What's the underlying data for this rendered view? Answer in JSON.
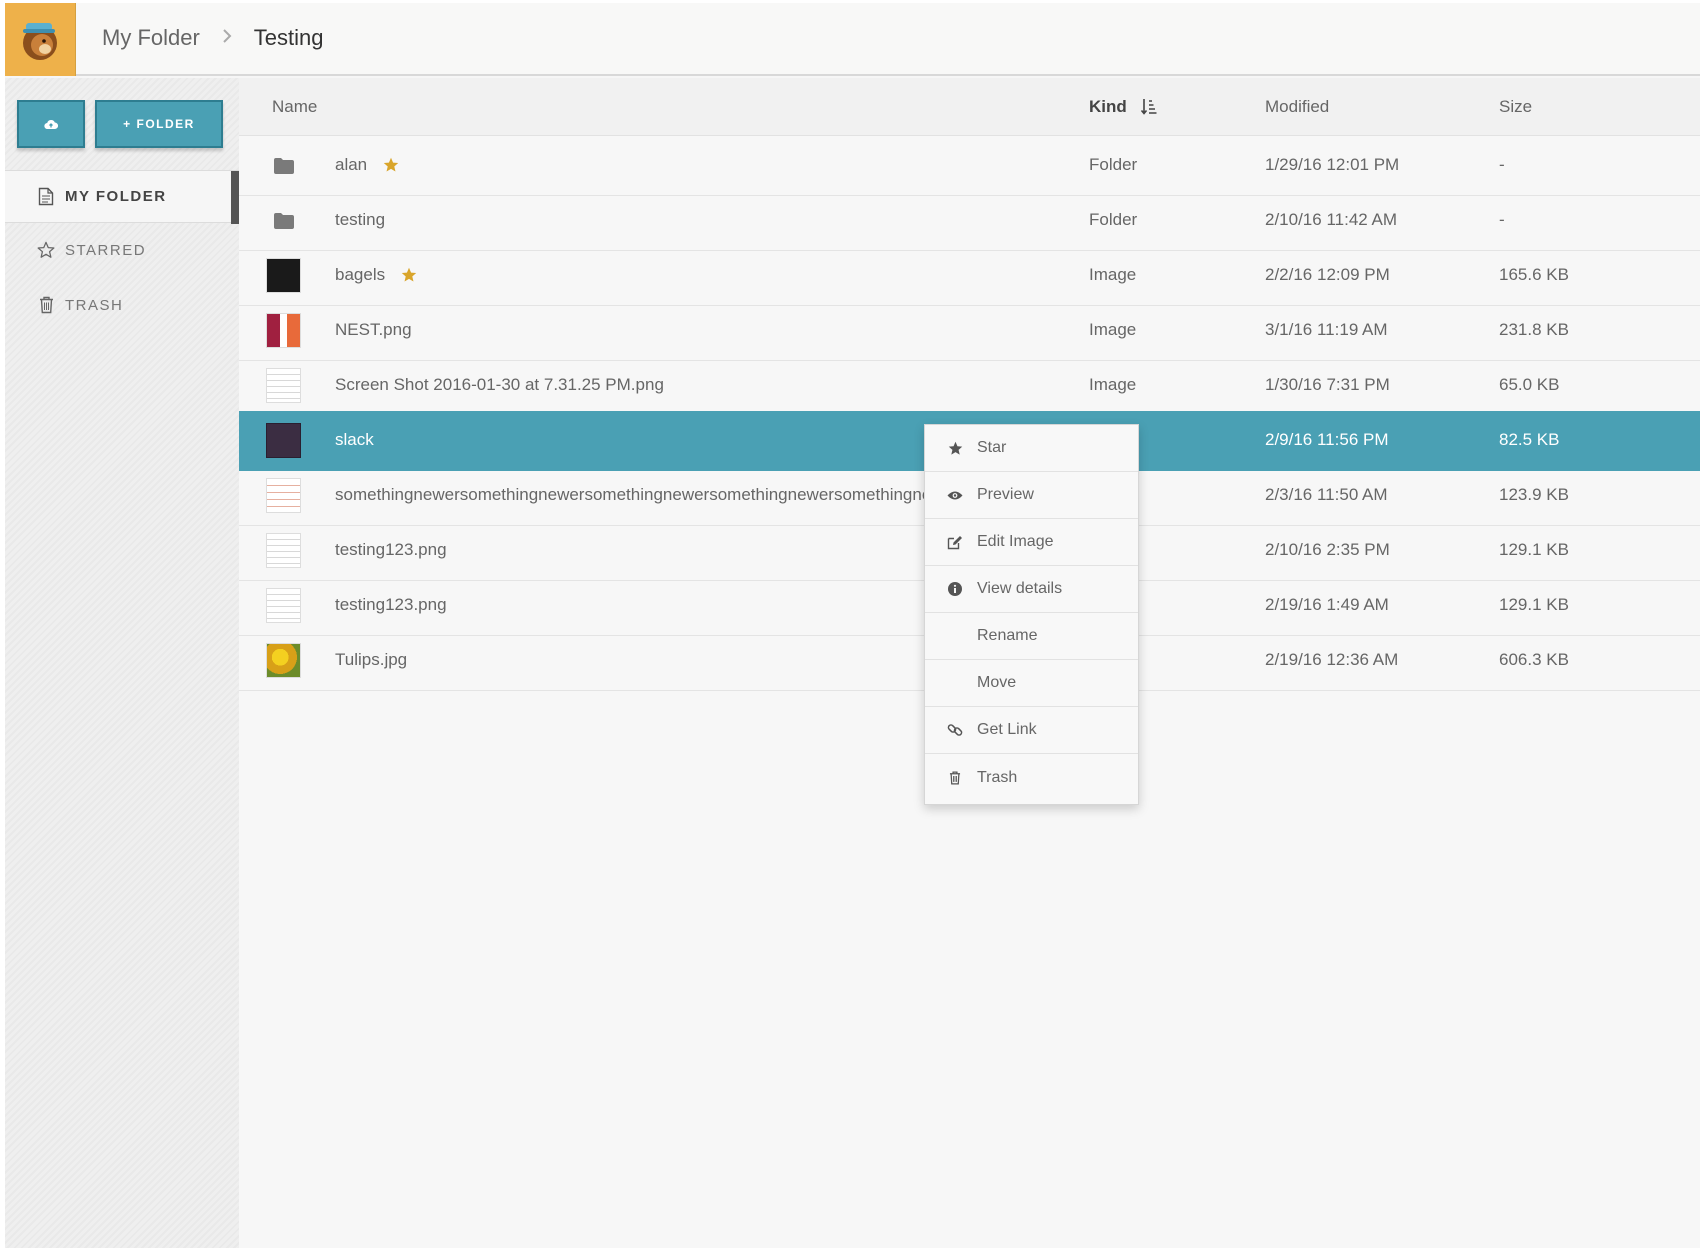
{
  "header": {
    "breadcrumb_parent": "My Folder",
    "breadcrumb_current": "Testing"
  },
  "sidebar": {
    "upload_icon": "cloud-upload-icon",
    "new_folder_label": "+ FOLDER",
    "items": [
      {
        "label": "MY FOLDER",
        "icon": "document-icon",
        "active": true
      },
      {
        "label": "STARRED",
        "icon": "star-outline-icon",
        "active": false
      },
      {
        "label": "TRASH",
        "icon": "trash-icon",
        "active": false
      }
    ]
  },
  "table": {
    "columns": {
      "name": "Name",
      "kind": "Kind",
      "modified": "Modified",
      "size": "Size"
    },
    "sorted_by": "Kind",
    "rows": [
      {
        "name": "alan",
        "starred": true,
        "kind": "Folder",
        "modified": "1/29/16 12:01 PM",
        "size": "-"
      },
      {
        "name": "testing",
        "starred": false,
        "kind": "Folder",
        "modified": "2/10/16 11:42 AM",
        "size": "-"
      },
      {
        "name": "bagels",
        "starred": true,
        "kind": "Image",
        "modified": "2/2/16 12:09 PM",
        "size": "165.6 KB"
      },
      {
        "name": "NEST.png",
        "starred": false,
        "kind": "Image",
        "modified": "3/1/16 11:19 AM",
        "size": "231.8 KB"
      },
      {
        "name": "Screen Shot 2016-01-30 at 7.31.25 PM.png",
        "starred": false,
        "kind": "Image",
        "modified": "1/30/16 7:31 PM",
        "size": "65.0 KB"
      },
      {
        "name": "slack",
        "starred": false,
        "kind": "",
        "modified": "2/9/16 11:56 PM",
        "size": "82.5 KB",
        "selected": true
      },
      {
        "name": "somethingnewersomethingnewersomethingnewersomethingnewersomethingnewerso",
        "starred": false,
        "kind": "",
        "modified": "2/3/16 11:50 AM",
        "size": "123.9 KB"
      },
      {
        "name": "testing123.png",
        "starred": false,
        "kind": "",
        "modified": "2/10/16 2:35 PM",
        "size": "129.1 KB"
      },
      {
        "name": "testing123.png",
        "starred": false,
        "kind": "",
        "modified": "2/19/16 1:49 AM",
        "size": "129.1 KB"
      },
      {
        "name": "Tulips.jpg",
        "starred": false,
        "kind": "",
        "modified": "2/19/16 12:36 AM",
        "size": "606.3 KB"
      }
    ]
  },
  "context_menu": {
    "items": [
      {
        "label": "Star",
        "icon": "star-icon"
      },
      {
        "label": "Preview",
        "icon": "eye-icon"
      },
      {
        "label": "Edit Image",
        "icon": "edit-icon"
      },
      {
        "label": "View details",
        "icon": "info-icon"
      },
      {
        "label": "Rename",
        "icon": ""
      },
      {
        "label": "Move",
        "icon": ""
      },
      {
        "label": "Get Link",
        "icon": "link-icon"
      },
      {
        "label": "Trash",
        "icon": "trash-icon"
      }
    ]
  },
  "colors": {
    "accent": "#4aa0b4",
    "logo_bg": "#eeb14a",
    "star": "#d9a52b"
  }
}
